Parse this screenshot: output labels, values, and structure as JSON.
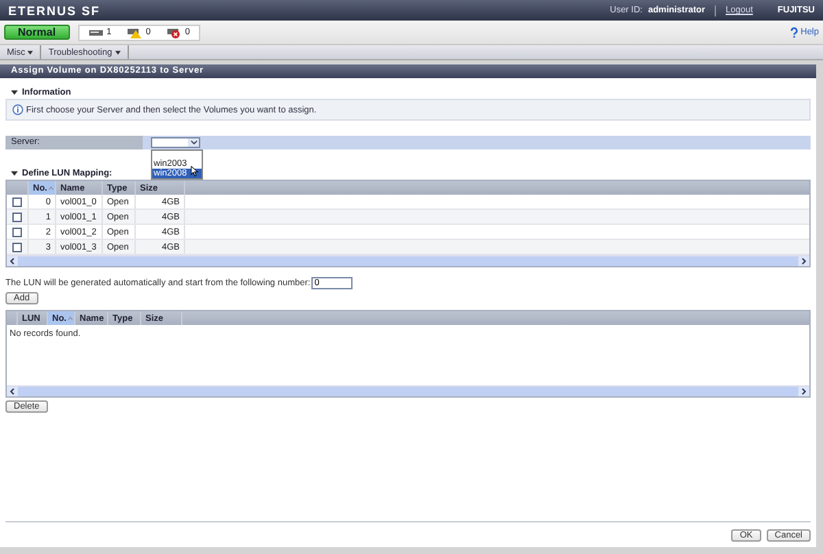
{
  "header": {
    "brand": "ETERNUS SF",
    "user_label": "User ID:",
    "user": "administrator",
    "logout": "Logout",
    "logo": "FUJITSU"
  },
  "status": {
    "state": "Normal",
    "counters": [
      {
        "kind": "device",
        "count": "1"
      },
      {
        "kind": "warning",
        "count": "0"
      },
      {
        "kind": "error",
        "count": "0"
      }
    ],
    "help": "Help"
  },
  "menu": [
    "Misc",
    "Troubleshooting"
  ],
  "title": "Assign Volume on DX80252113 to Server",
  "information": {
    "heading": "Information",
    "expanded": true,
    "message": "First choose your Server and then select the Volumes you want to assign."
  },
  "server": {
    "label": "Server:",
    "options": [
      {
        "label": "win2003",
        "selected": false
      },
      {
        "label": "win2008",
        "selected": true
      }
    ]
  },
  "mapping": {
    "heading": "Define LUN Mapping:",
    "expanded": true,
    "columns": [
      {
        "label": "No.",
        "sorted": true
      },
      {
        "label": "Name",
        "sorted": false
      },
      {
        "label": "Type",
        "sorted": false
      },
      {
        "label": "Size",
        "sorted": false
      }
    ],
    "rows": [
      {
        "checked": false,
        "no": "0",
        "name": "vol001_0",
        "type": "Open",
        "size": "4GB"
      },
      {
        "checked": false,
        "no": "1",
        "name": "vol001_1",
        "type": "Open",
        "size": "4GB"
      },
      {
        "checked": false,
        "no": "2",
        "name": "vol001_2",
        "type": "Open",
        "size": "4GB"
      },
      {
        "checked": false,
        "no": "3",
        "name": "vol001_3",
        "type": "Open",
        "size": "4GB"
      }
    ]
  },
  "lun_start": {
    "label": "The LUN will be generated automatically and start from the following number:",
    "value": "0"
  },
  "add_button": "Add",
  "assigned": {
    "columns": [
      {
        "label": "LUN",
        "sorted": false
      },
      {
        "label": "No.",
        "sorted": true
      },
      {
        "label": "Name",
        "sorted": false
      },
      {
        "label": "Type",
        "sorted": false
      },
      {
        "label": "Size",
        "sorted": false
      }
    ],
    "empty": "No records found."
  },
  "delete_button": "Delete",
  "footer": [
    "OK",
    "Cancel"
  ]
}
